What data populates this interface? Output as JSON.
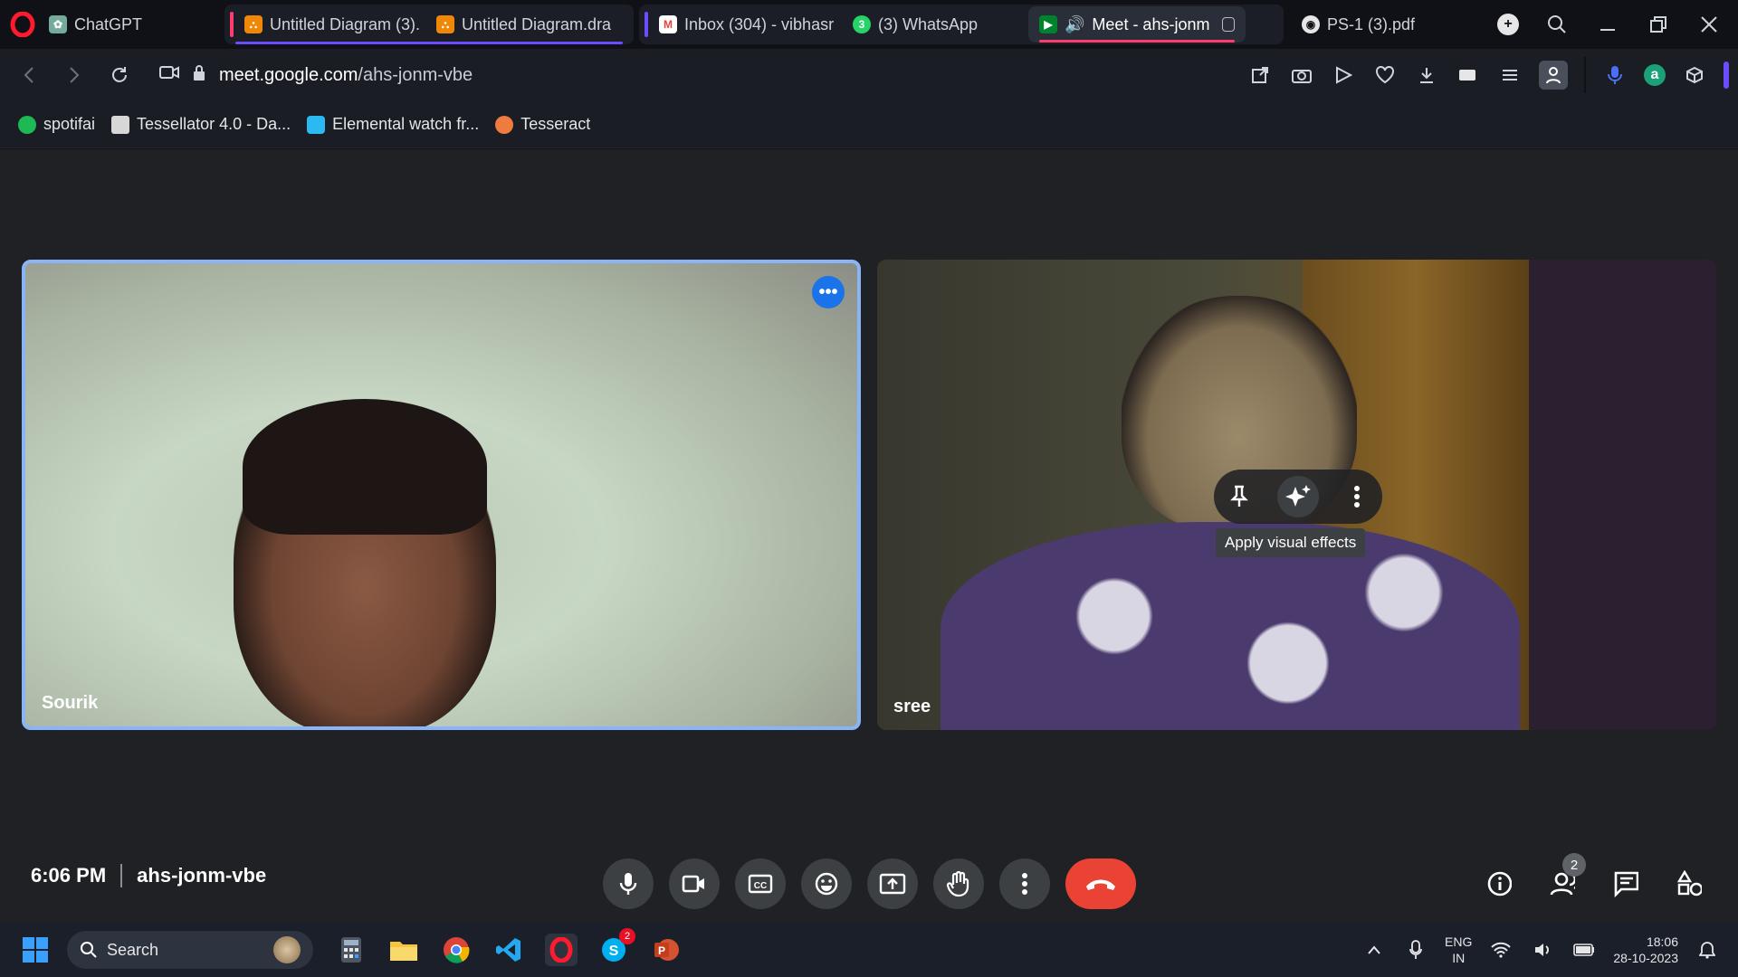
{
  "browser": {
    "tabs": [
      {
        "label": "ChatGPT",
        "color": "#74aa9c"
      },
      {
        "label": "Untitled Diagram (3).",
        "color": "#f08705"
      },
      {
        "label": "Untitled Diagram.dra",
        "color": "#f08705"
      },
      {
        "label": "Inbox (304) - vibhasr",
        "color": "#ea4335"
      },
      {
        "label": "(3) WhatsApp",
        "color": "#25d366"
      },
      {
        "label": "Meet - ahs-jonm",
        "color": "#00832d"
      },
      {
        "label": "PS-1 (3).pdf",
        "color": "#cfd3db"
      }
    ],
    "url_host": "meet.google.com",
    "url_path": "/ahs-jonm-vbe",
    "bookmarks": [
      {
        "label": "spotifai",
        "color": "#1db954"
      },
      {
        "label": "Tessellator 4.0 - Da...",
        "color": "#d7d7d7"
      },
      {
        "label": "Elemental watch fr...",
        "color": "#2ab9f0"
      },
      {
        "label": "Tesseract",
        "color": "#f07b3f"
      }
    ]
  },
  "meet": {
    "participants": [
      {
        "name": "Sourik"
      },
      {
        "name": "sree"
      }
    ],
    "tooltip": "Apply visual effects",
    "time": "6:06 PM",
    "meeting_code": "ahs-jonm-vbe",
    "people_count": "2",
    "colors": {
      "accent": "#8ab4f8",
      "end_call": "#ea4335",
      "control_bg": "#3c4043"
    }
  },
  "taskbar": {
    "search_placeholder": "Search",
    "language_line1": "ENG",
    "language_line2": "IN",
    "time": "18:06",
    "date": "28-10-2023",
    "skype_badge": "2"
  }
}
